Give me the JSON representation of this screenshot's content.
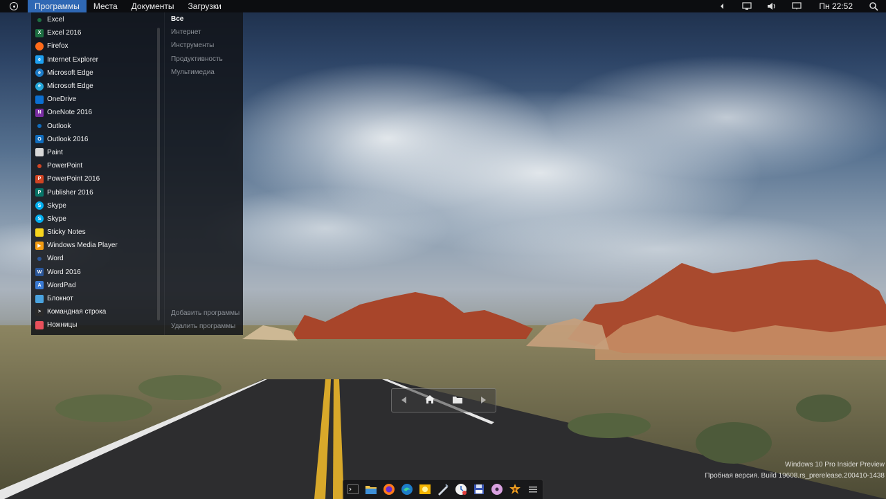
{
  "top_panel": {
    "menus": [
      "Программы",
      "Места",
      "Документы",
      "Загрузки"
    ],
    "clock": "Пн 22:52",
    "tray_icons": [
      "dropdown-arrow-icon",
      "network-icon",
      "volume-icon",
      "notifications-icon"
    ]
  },
  "apps": [
    {
      "label": "Excel",
      "icon": "excel-icon",
      "color": "#1d6f42"
    },
    {
      "label": "Excel 2016",
      "icon": "excel-icon",
      "color": "#1d6f42"
    },
    {
      "label": "Firefox",
      "icon": "firefox-icon",
      "color": "#ff6b1a"
    },
    {
      "label": "Internet Explorer",
      "icon": "internet-explorer-icon",
      "color": "#1ea0f0"
    },
    {
      "label": "Microsoft Edge",
      "icon": "edge-icon",
      "color": "#1d7cc8"
    },
    {
      "label": "Microsoft Edge",
      "icon": "edge-icon",
      "color": "#25a6d9"
    },
    {
      "label": "OneDrive",
      "icon": "onedrive-icon",
      "color": "#0b6fd1"
    },
    {
      "label": "OneNote 2016",
      "icon": "onenote-icon",
      "color": "#7b2ea3"
    },
    {
      "label": "Outlook",
      "icon": "outlook-icon",
      "color": "#0f6cbd"
    },
    {
      "label": "Outlook 2016",
      "icon": "outlook-icon",
      "color": "#0f6cbd"
    },
    {
      "label": "Paint",
      "icon": "paint-icon",
      "color": "#d8d8d8"
    },
    {
      "label": "PowerPoint",
      "icon": "powerpoint-icon",
      "color": "#d04423"
    },
    {
      "label": "PowerPoint 2016",
      "icon": "powerpoint-icon",
      "color": "#d04423"
    },
    {
      "label": "Publisher 2016",
      "icon": "publisher-icon",
      "color": "#077568"
    },
    {
      "label": "Skype",
      "icon": "skype-icon",
      "color": "#00aff0"
    },
    {
      "label": "Skype",
      "icon": "skype-icon",
      "color": "#00aff0"
    },
    {
      "label": "Sticky Notes",
      "icon": "sticky-notes-icon",
      "color": "#f7d51d"
    },
    {
      "label": "Windows Media Player",
      "icon": "media-player-icon",
      "color": "#f39c12"
    },
    {
      "label": "Word",
      "icon": "word-icon",
      "color": "#2b579a"
    },
    {
      "label": "Word 2016",
      "icon": "word-icon",
      "color": "#2b579a"
    },
    {
      "label": "WordPad",
      "icon": "wordpad-icon",
      "color": "#3a7bd5"
    },
    {
      "label": "Блокнот",
      "icon": "notepad-icon",
      "color": "#4aa3df"
    },
    {
      "label": "Командная строка",
      "icon": "command-prompt-icon",
      "color": "#2a2a2a"
    },
    {
      "label": "Ножницы",
      "icon": "snipping-tool-icon",
      "color": "#e8505b"
    }
  ],
  "categories": {
    "items": [
      "Все",
      "Интернет",
      "Инструменты",
      "Продуктивность",
      "Мультимедиа"
    ],
    "selected": "Все",
    "actions": [
      "Добавить программы",
      "Удалить программы"
    ]
  },
  "nav_widget": {
    "buttons": [
      "back-arrow-icon",
      "home-icon",
      "folder-icon",
      "forward-arrow-icon"
    ]
  },
  "dock": {
    "icons": [
      "terminal-icon",
      "files-icon",
      "firefox-icon",
      "edge-icon",
      "photo-viewer-icon",
      "pen-icon",
      "clock-icon",
      "save-icon",
      "disc-burner-icon",
      "cookie-icon",
      "menu-icon"
    ]
  },
  "watermark": {
    "line1": "Windows 10 Pro Insider Preview",
    "line2": "Пробная версия. Build 19608.rs_prerelease.200410-1438"
  }
}
